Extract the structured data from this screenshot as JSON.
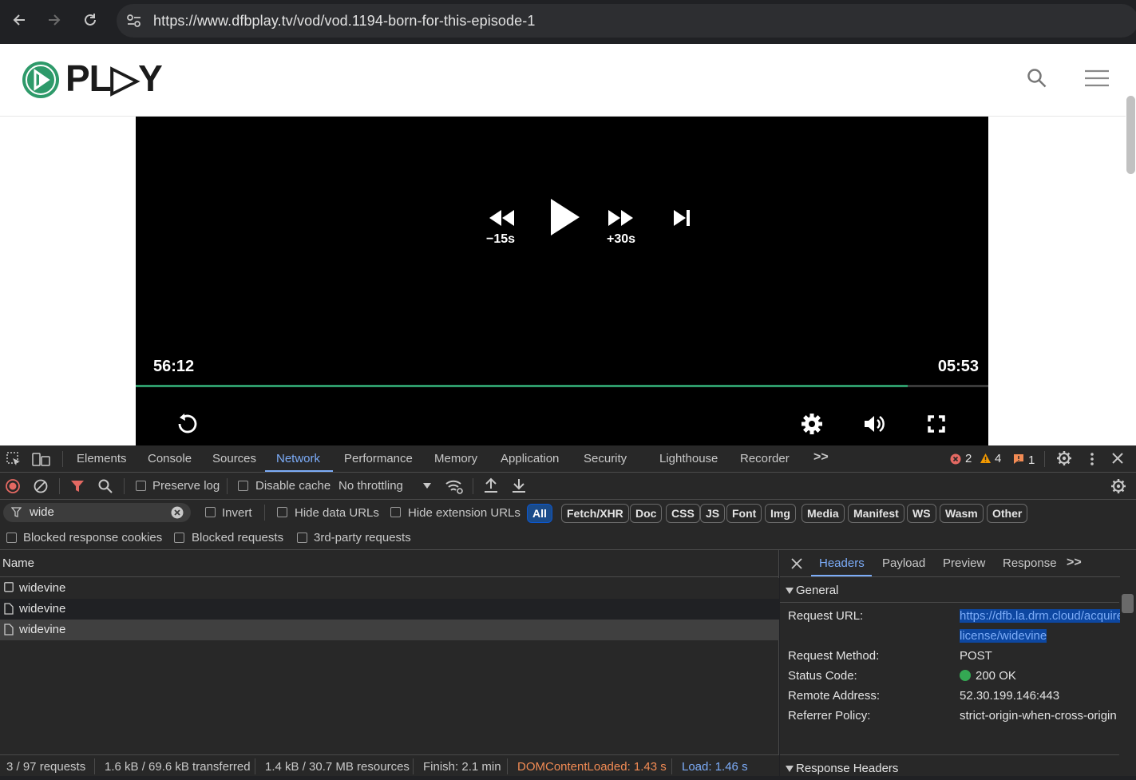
{
  "browser": {
    "url": "https://www.dfbplay.tv/vod/vod.1194-born-for-this-episode-1",
    "icons": [
      "back-icon",
      "forward-icon",
      "reload-icon",
      "site-settings-icon"
    ]
  },
  "site": {
    "logo_text": "PL▷Y",
    "accent": "#2e9a6a",
    "icons": [
      "search-icon",
      "menu-icon"
    ]
  },
  "player": {
    "rewind_label": "−15s",
    "forward_label": "+30s",
    "elapsed": "56:12",
    "remaining": "05:53",
    "progress": 0.905
  },
  "devtools": {
    "tabs": [
      "Elements",
      "Console",
      "Sources",
      "Network",
      "Performance",
      "Memory",
      "Application",
      "Security",
      "Lighthouse",
      "Recorder"
    ],
    "active_tab": "Network",
    "more_tabs": ">>",
    "errors": "2",
    "warnings": "4",
    "issues": "1",
    "toolbar": {
      "preserve_log": "Preserve log",
      "disable_cache": "Disable cache",
      "throttling": "No throttling"
    },
    "filter": {
      "value": "wide",
      "invert": "Invert",
      "hide_data_urls": "Hide data URLs",
      "hide_extension_urls": "Hide extension URLs",
      "types": [
        "All",
        "Fetch/XHR",
        "Doc",
        "CSS",
        "JS",
        "Font",
        "Img",
        "Media",
        "Manifest",
        "WS",
        "Wasm",
        "Other"
      ],
      "blocked_cookies": "Blocked response cookies",
      "blocked_requests": "Blocked requests",
      "third_party": "3rd-party requests"
    },
    "requests": {
      "header": "Name",
      "rows": [
        "widevine",
        "widevine",
        "widevine"
      ]
    },
    "status": {
      "requests": "3 / 97 requests",
      "transferred": "1.6 kB / 69.6 kB transferred",
      "resources": "1.4 kB / 30.7 MB resources",
      "finish": "Finish: 2.1 min",
      "dcl": "DOMContentLoaded: 1.43 s",
      "load": "Load: 1.46 s"
    },
    "details": {
      "tabs": [
        "Headers",
        "Payload",
        "Preview",
        "Response"
      ],
      "more": ">>",
      "general_title": "General",
      "request_url_label": "Request URL:",
      "request_url_value": "https://dfb.la.drm.cloud/acquire-license/widevine",
      "request_method_label": "Request Method:",
      "request_method_value": "POST",
      "status_code_label": "Status Code:",
      "status_code_value": "200 OK",
      "remote_address_label": "Remote Address:",
      "remote_address_value": "52.30.199.146:443",
      "referrer_policy_label": "Referrer Policy:",
      "referrer_policy_value": "strict-origin-when-cross-origin",
      "response_headers_title": "Response Headers"
    }
  }
}
